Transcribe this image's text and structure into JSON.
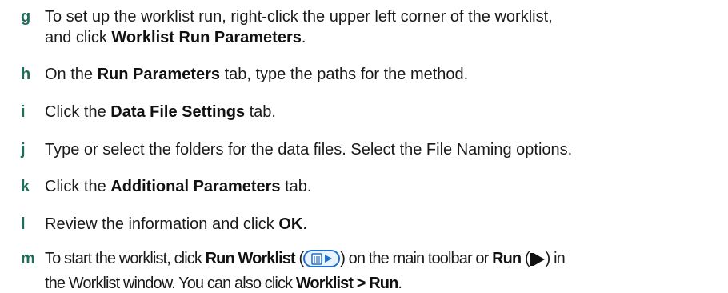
{
  "steps": [
    {
      "letter": "g",
      "text1": "To set up the worklist run, right-click the upper left corner of the worklist,",
      "text2": "and click ",
      "bold1": "Worklist Run Parameters",
      "text3": "."
    },
    {
      "letter": "h",
      "text1": "On the ",
      "bold1": "Run Parameters",
      "text2": " tab, type the paths for the method."
    },
    {
      "letter": "i",
      "text1": "Click the ",
      "bold1": "Data File Settings",
      "text2": " tab."
    },
    {
      "letter": "j",
      "text1": "Type or select the folders for the data files. Select the File Naming options."
    },
    {
      "letter": "k",
      "text1": "Click the ",
      "bold1": "Additional Parameters",
      "text2": " tab."
    },
    {
      "letter": "l",
      "text1": "Review the information and click ",
      "bold1": "OK",
      "text2": "."
    },
    {
      "letter": "m",
      "text1": "To start the worklist, click ",
      "bold1": "Run Worklist",
      "text2": " (",
      "text3": ") on the main toolbar or ",
      "bold2": "Run",
      "text4": " (",
      "text5": ") in",
      "text6": "the Worklist window. You can also click ",
      "bold3": "Worklist > Run",
      "text7": "."
    }
  ],
  "icons": {
    "run_worklist": "run-worklist-icon",
    "run": "run-play-icon",
    "accent_color": "#1f6e5a",
    "icon_blue": "#1e6fd0"
  }
}
